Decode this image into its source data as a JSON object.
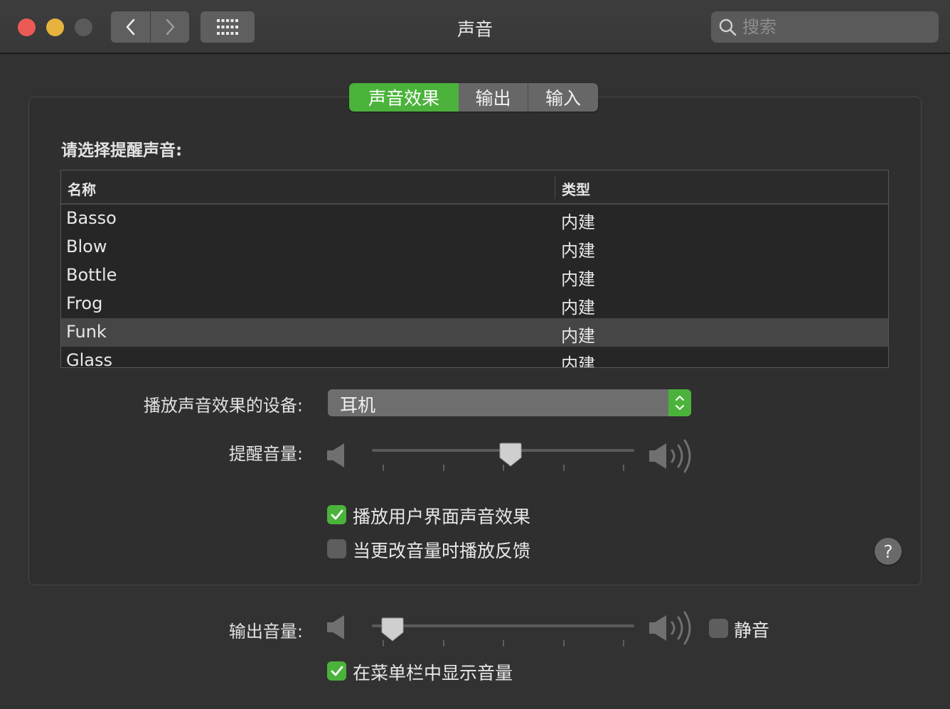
{
  "window": {
    "title": "声音",
    "search_placeholder": "搜索"
  },
  "tabs": [
    {
      "label": "声音效果",
      "active": true
    },
    {
      "label": "输出",
      "active": false
    },
    {
      "label": "输入",
      "active": false
    }
  ],
  "sound_effects": {
    "section_label": "请选择提醒声音:",
    "table": {
      "headers": {
        "name": "名称",
        "type": "类型"
      },
      "rows": [
        {
          "name": "Basso",
          "type": "内建"
        },
        {
          "name": "Blow",
          "type": "内建"
        },
        {
          "name": "Bottle",
          "type": "内建"
        },
        {
          "name": "Frog",
          "type": "内建"
        },
        {
          "name": "Funk",
          "type": "内建",
          "selected": true
        },
        {
          "name": "Glass",
          "type": "内建"
        }
      ]
    },
    "device_label": "播放声音效果的设备:",
    "device_value": "耳机",
    "alert_volume_label": "提醒音量:",
    "alert_volume": 0.53,
    "play_ui_sounds": {
      "label": "播放用户界面声音效果",
      "checked": true
    },
    "feedback_on_change": {
      "label": "当更改音量时播放反馈",
      "checked": false
    },
    "help_label": "?"
  },
  "output": {
    "volume_label": "输出音量:",
    "volume": 0.04,
    "mute": {
      "label": "静音",
      "checked": false
    },
    "show_in_menubar": {
      "label": "在菜单栏中显示音量",
      "checked": true
    }
  },
  "colors": {
    "accent": "#4bb33b",
    "window_bg": "#323232",
    "close": "#ec5a55",
    "minimize": "#e6b33e"
  }
}
